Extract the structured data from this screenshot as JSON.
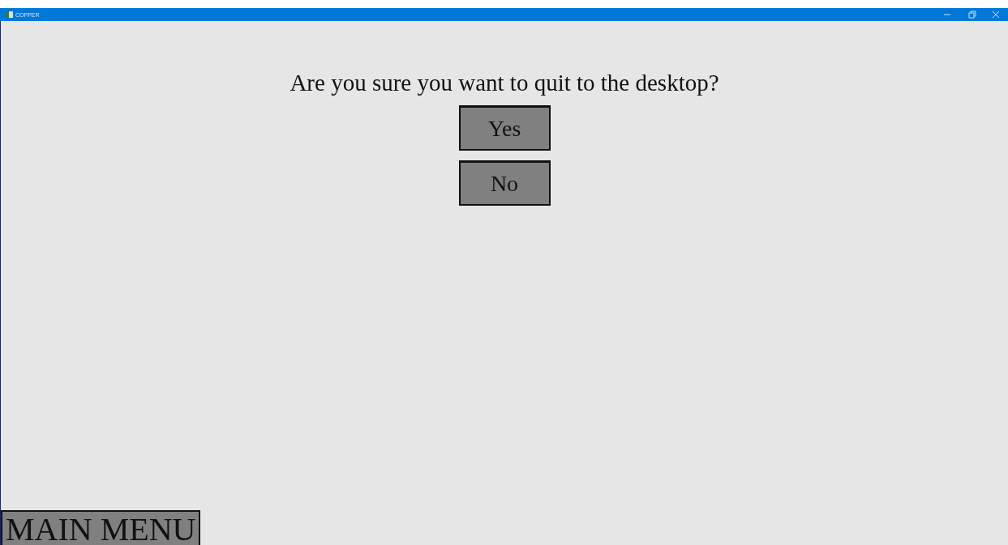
{
  "window": {
    "title": "COPPER"
  },
  "dialog": {
    "question": "Are you sure you want to quit to the desktop?",
    "buttons": [
      "Yes",
      "No"
    ]
  },
  "main_menu_button": "MAIN MENU"
}
